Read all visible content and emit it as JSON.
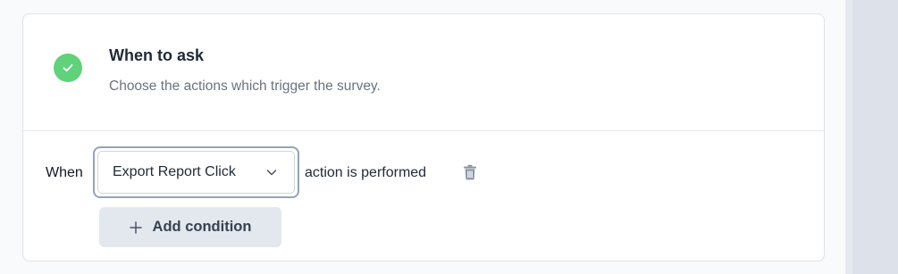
{
  "header": {
    "title": "When to ask",
    "subtitle": "Choose the actions which trigger the survey.",
    "status_icon": "check-circle-icon",
    "status_color": "#5fd27a"
  },
  "trigger": {
    "when_label": "When",
    "selected_action": "Export Report Click",
    "suffix": "action is performed",
    "delete_icon": "trash-icon"
  },
  "add_condition": {
    "label": "Add condition",
    "icon": "plus-icon"
  }
}
